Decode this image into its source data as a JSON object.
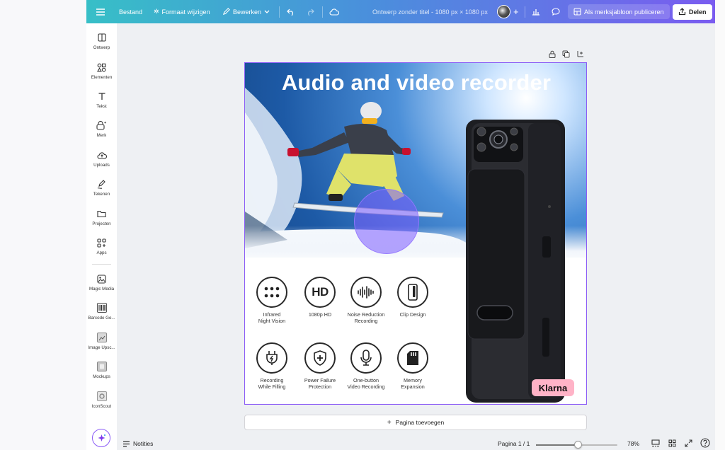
{
  "topbar": {
    "file": "Bestand",
    "resize": "Formaat wijzigen",
    "edit": "Bewerken",
    "doc_title": "Ontwerp zonder titel - 1080 px × 1080 px",
    "publish": "Als merksjabloon publiceren",
    "share": "Delen"
  },
  "sidebar": {
    "items": [
      {
        "label": "Ontwerp",
        "icon": "layout-icon"
      },
      {
        "label": "Elementen",
        "icon": "shapes-icon"
      },
      {
        "label": "Tekst",
        "icon": "text-icon"
      },
      {
        "label": "Merk",
        "icon": "brand-icon"
      },
      {
        "label": "Uploads",
        "icon": "upload-cloud-icon"
      },
      {
        "label": "Tekenen",
        "icon": "draw-icon"
      },
      {
        "label": "Projecten",
        "icon": "folder-icon"
      },
      {
        "label": "Apps",
        "icon": "apps-icon"
      },
      {
        "label": "Magic Media",
        "icon": "magic-media-icon"
      },
      {
        "label": "Barcode Ge...",
        "icon": "barcode-icon"
      },
      {
        "label": "Image Upsc...",
        "icon": "image-upscaler-icon"
      },
      {
        "label": "Mockups",
        "icon": "mockups-icon"
      },
      {
        "label": "IconScout",
        "icon": "iconscout-icon"
      }
    ]
  },
  "design": {
    "headline": "Audio and video recorder",
    "features": [
      {
        "caption": "Infrared\nNight Vision",
        "icon": "dots-grid-icon"
      },
      {
        "caption": "1080p HD",
        "icon": "hd-icon",
        "glyph": "HD"
      },
      {
        "caption": "Noise Reduction\nRecording",
        "icon": "waveform-icon"
      },
      {
        "caption": "Clip Design",
        "icon": "clip-icon"
      },
      {
        "caption": "Recording\nWhile Filling",
        "icon": "charging-icon"
      },
      {
        "caption": "Power Failure\nProtection",
        "icon": "shield-plus-icon"
      },
      {
        "caption": "One-button\nVideo Recording",
        "icon": "microphone-icon"
      },
      {
        "caption": "Memory\nExpansion",
        "icon": "sd-card-icon"
      }
    ],
    "badge": "Klarna"
  },
  "add_page": "Pagina toevoegen",
  "bottom": {
    "notes": "Notities",
    "page_indicator": "Pagina 1 / 1",
    "zoom": "78%",
    "zoom_fraction": 0.52
  },
  "colors": {
    "accent": "#8b5cf6",
    "topbar_start": "#37bfc7",
    "topbar_end": "#7a5cf0",
    "klarna_pink": "#ffb3c7"
  }
}
